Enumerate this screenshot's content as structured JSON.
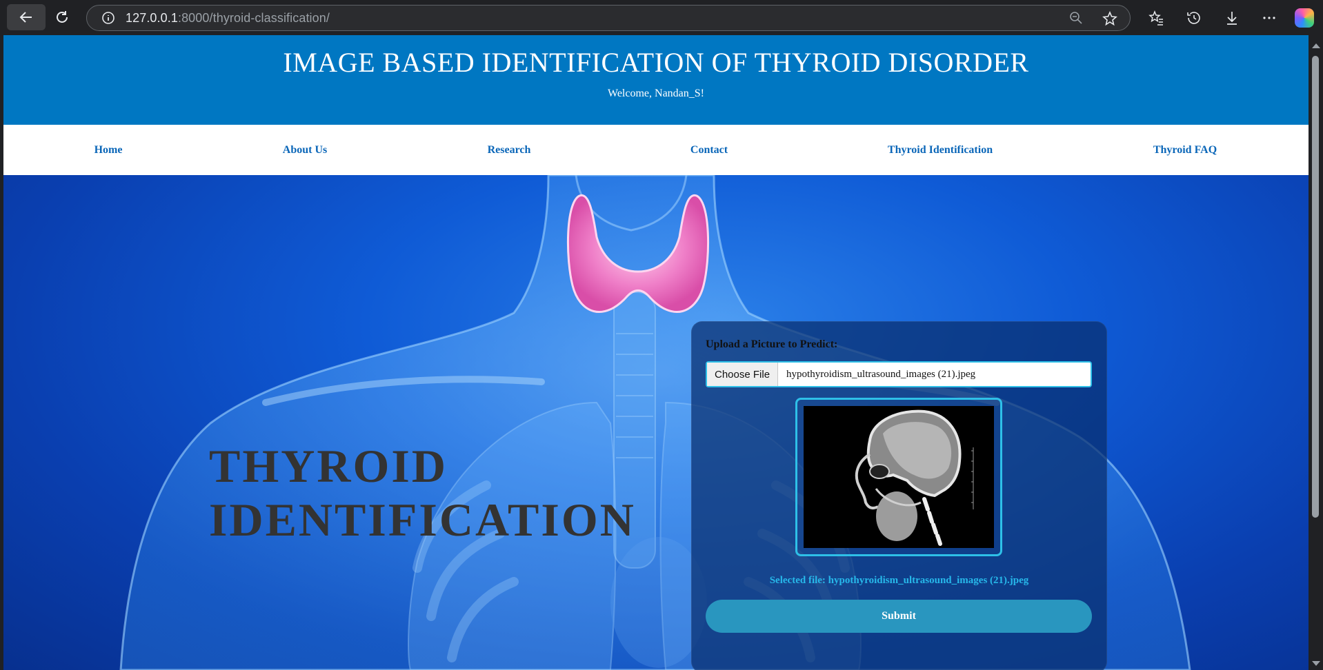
{
  "browser": {
    "url_host": "127.0.0.1",
    "url_rest": ":8000/thyroid-classification/",
    "icons": [
      "back-arrow-icon",
      "reload-icon",
      "info-icon",
      "zoom-out-icon",
      "star-icon",
      "favorites-icon",
      "history-icon",
      "download-icon",
      "more-icon",
      "copilot-icon"
    ]
  },
  "header": {
    "title": "IMAGE BASED IDENTIFICATION OF THYROID DISORDER",
    "welcome": "Welcome, Nandan_S!",
    "bg_color": "#0077c2"
  },
  "nav": {
    "items": [
      {
        "label": "Home"
      },
      {
        "label": "About Us"
      },
      {
        "label": "Research"
      },
      {
        "label": "Contact"
      },
      {
        "label": "Thyroid Identification"
      },
      {
        "label": "Thyroid FAQ"
      }
    ],
    "link_color": "#0a66b8"
  },
  "hero": {
    "title_line1": "THYROID",
    "title_line2": "IDENTIFICATION"
  },
  "upload": {
    "label": "Upload a Picture to Predict:",
    "choose_button": "Choose File",
    "file_name": "hypothyroidism_ultrasound_images (21).jpeg",
    "selected_text": "Selected file: hypothyroidism_ultrasound_images (21).jpeg",
    "submit_label": "Submit",
    "accent_color": "#2ec0e8"
  }
}
